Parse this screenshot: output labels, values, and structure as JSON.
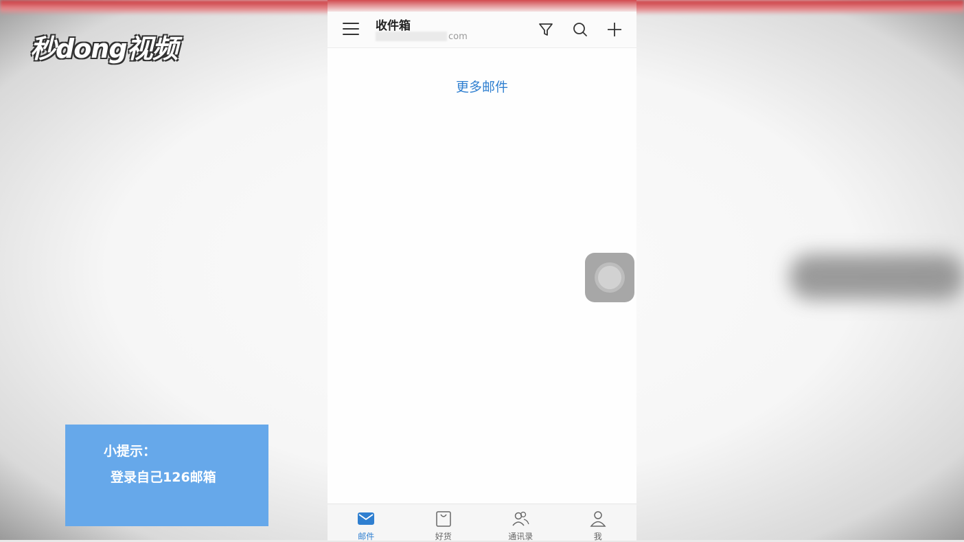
{
  "watermark": {
    "logo_text": "秒dong视频"
  },
  "app": {
    "header": {
      "title": "收件箱",
      "account_visible_suffix": "com"
    },
    "list": {
      "more_mail_label": "更多邮件"
    },
    "tabs": [
      {
        "label": "邮件",
        "icon": "mail-icon",
        "active": true
      },
      {
        "label": "好货",
        "icon": "shopping-bag-icon",
        "active": false
      },
      {
        "label": "通讯录",
        "icon": "contacts-icon",
        "active": false
      },
      {
        "label": "我",
        "icon": "person-icon",
        "active": false
      }
    ],
    "colors": {
      "accent": "#2f7fd0",
      "brand_red": "#d24a4f"
    }
  },
  "tip": {
    "title": "小提示：",
    "body": "登录自己126邮箱",
    "background": "#66a8ea"
  }
}
